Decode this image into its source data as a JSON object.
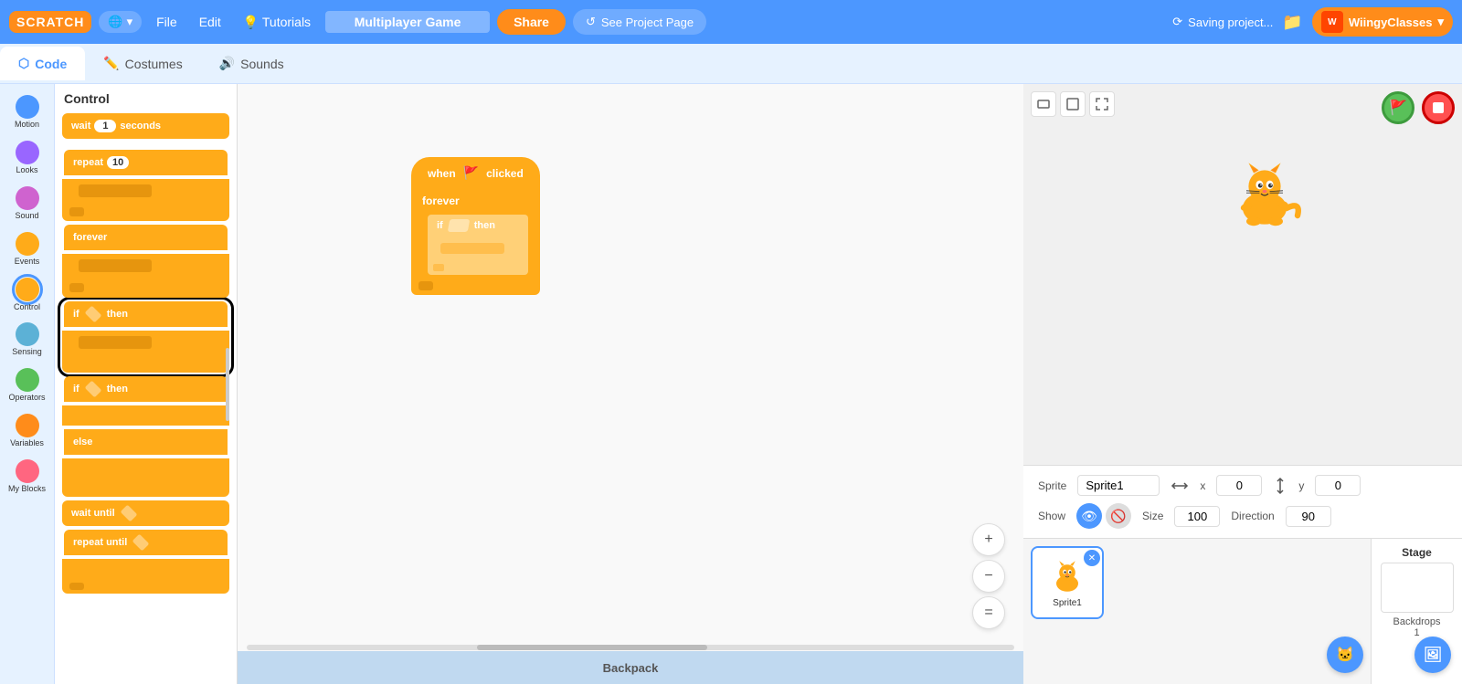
{
  "app": {
    "logo": "SCRATCH",
    "project_name": "Multiplayer Game",
    "saving_text": "Saving project...",
    "username": "WiingyClasses"
  },
  "navbar": {
    "globe_label": "🌐",
    "file_label": "File",
    "edit_label": "Edit",
    "tutorials_label": "Tutorials",
    "share_label": "Share",
    "see_project_label": "See Project Page"
  },
  "tabs": [
    {
      "id": "code",
      "label": "Code",
      "active": true
    },
    {
      "id": "costumes",
      "label": "Costumes",
      "active": false
    },
    {
      "id": "sounds",
      "label": "Sounds",
      "active": false
    }
  ],
  "categories": [
    {
      "id": "motion",
      "label": "Motion",
      "color": "#4C97FF"
    },
    {
      "id": "looks",
      "label": "Looks",
      "color": "#9966FF"
    },
    {
      "id": "sound",
      "label": "Sound",
      "color": "#CF63CF"
    },
    {
      "id": "events",
      "label": "Events",
      "color": "#FFAB19"
    },
    {
      "id": "control",
      "label": "Control",
      "color": "#FFAB19",
      "active": true
    },
    {
      "id": "sensing",
      "label": "Sensing",
      "color": "#5CB1D6"
    },
    {
      "id": "operators",
      "label": "Operators",
      "color": "#59C059"
    },
    {
      "id": "variables",
      "label": "Variables",
      "color": "#FF8C1A"
    },
    {
      "id": "my_blocks",
      "label": "My Blocks",
      "color": "#FF6680"
    }
  ],
  "blocks_panel": {
    "title": "Control",
    "blocks": [
      {
        "type": "wait",
        "text": "wait",
        "input": "1",
        "suffix": "seconds"
      },
      {
        "type": "repeat",
        "text": "repeat",
        "input": "10"
      },
      {
        "type": "forever",
        "text": "forever"
      },
      {
        "type": "if_then",
        "text": "if",
        "suffix": "then",
        "selected": true
      },
      {
        "type": "if_then_else",
        "text": "if",
        "suffix": "then"
      },
      {
        "type": "else",
        "text": "else"
      },
      {
        "type": "wait_until",
        "text": "wait until"
      },
      {
        "type": "repeat_until",
        "text": "repeat until"
      }
    ]
  },
  "canvas": {
    "hat_block": "when 🚩 clicked",
    "forever_label": "forever",
    "if_label": "if",
    "then_label": "then"
  },
  "sprite_inspector": {
    "sprite_label": "Sprite",
    "sprite_name": "Sprite1",
    "x_label": "x",
    "x_value": "0",
    "y_label": "y",
    "y_value": "0",
    "show_label": "Show",
    "size_label": "Size",
    "size_value": "100",
    "direction_label": "Direction",
    "direction_value": "90"
  },
  "sprites": [
    {
      "name": "Sprite1",
      "selected": true
    }
  ],
  "stage": {
    "title": "Stage",
    "backdrops_label": "Backdrops",
    "backdrops_count": "1"
  },
  "zoom_controls": {
    "zoom_in": "+",
    "zoom_out": "−",
    "fit": "="
  },
  "backpack": {
    "label": "Backpack"
  }
}
